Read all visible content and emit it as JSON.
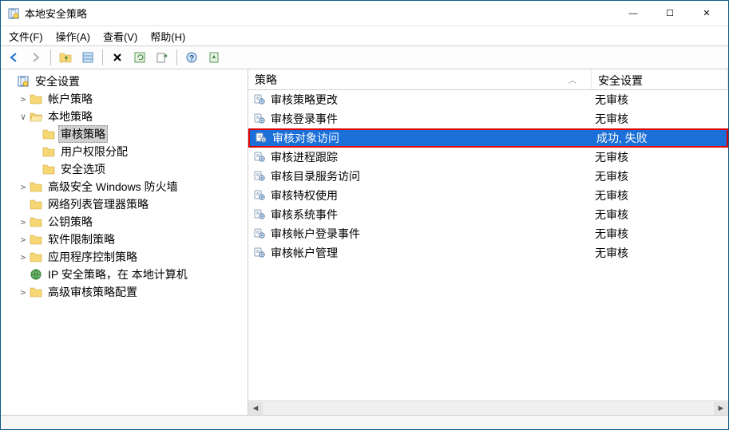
{
  "window": {
    "title": "本地安全策略"
  },
  "menu": {
    "file": "文件(F)",
    "action": "操作(A)",
    "view": "查看(V)",
    "help": "帮助(H)"
  },
  "toolbar_icons": {
    "back": "back-arrow",
    "forward": "forward-arrow",
    "up": "up-folder",
    "list": "list-view",
    "delete": "delete",
    "refresh": "refresh",
    "export": "export",
    "help": "help",
    "props": "properties"
  },
  "tree": {
    "root": "安全设置",
    "items": [
      {
        "label": "帐户策略",
        "expandable": true,
        "expanded": false
      },
      {
        "label": "本地策略",
        "expandable": true,
        "expanded": true,
        "children": [
          {
            "label": "审核策略",
            "selected": true
          },
          {
            "label": "用户权限分配"
          },
          {
            "label": "安全选项"
          }
        ]
      },
      {
        "label": "高级安全 Windows 防火墙",
        "expandable": true,
        "expanded": false
      },
      {
        "label": "网络列表管理器策略",
        "expandable": false
      },
      {
        "label": "公钥策略",
        "expandable": true,
        "expanded": false
      },
      {
        "label": "软件限制策略",
        "expandable": true,
        "expanded": false
      },
      {
        "label": "应用程序控制策略",
        "expandable": true,
        "expanded": false
      },
      {
        "label": "IP 安全策略，在 本地计算机",
        "icon": "ipsec"
      },
      {
        "label": "高级审核策略配置",
        "expandable": true,
        "expanded": false
      }
    ]
  },
  "list": {
    "columns": {
      "policy": "策略",
      "setting": "安全设置"
    },
    "rows": [
      {
        "policy": "审核策略更改",
        "setting": "无审核"
      },
      {
        "policy": "审核登录事件",
        "setting": "无审核"
      },
      {
        "policy": "审核对象访问",
        "setting": "成功, 失败",
        "selected": true,
        "highlight": true
      },
      {
        "policy": "审核进程跟踪",
        "setting": "无审核"
      },
      {
        "policy": "审核目录服务访问",
        "setting": "无审核"
      },
      {
        "policy": "审核特权使用",
        "setting": "无审核"
      },
      {
        "policy": "审核系统事件",
        "setting": "无审核"
      },
      {
        "policy": "审核帐户登录事件",
        "setting": "无审核"
      },
      {
        "policy": "审核帐户管理",
        "setting": "无审核"
      }
    ]
  },
  "win_controls": {
    "min": "—",
    "max": "☐",
    "close": "✕"
  },
  "expander": {
    "open": "∨",
    "closed": ">"
  },
  "sort_caret": "︿"
}
